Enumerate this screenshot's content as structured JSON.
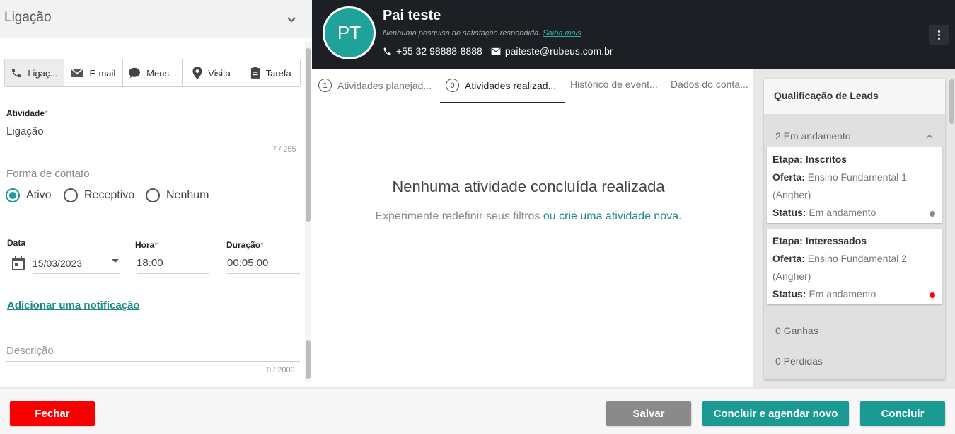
{
  "left": {
    "title": "Ligação",
    "tabs": [
      {
        "label": "Ligaç...",
        "icon": "phone-icon"
      },
      {
        "label": "E-mail",
        "icon": "mail-icon"
      },
      {
        "label": "Mens...",
        "icon": "chat-icon"
      },
      {
        "label": "Visita",
        "icon": "location-pin-icon"
      },
      {
        "label": "Tarefa",
        "icon": "clipboard-icon"
      }
    ],
    "atividade": {
      "label": "Atividade",
      "required": "*",
      "value": "Ligação",
      "counter": "7 / 255"
    },
    "forma_contato": {
      "label": "Forma de contato",
      "options": [
        "Ativo",
        "Receptivo",
        "Nenhum"
      ],
      "selected": "Ativo"
    },
    "data": {
      "label": "Data",
      "value": "15/03/2023"
    },
    "hora": {
      "label": "Hora",
      "required": "*",
      "value": "18:00"
    },
    "duracao": {
      "label": "Duração",
      "required": "*",
      "value": "00:05:00"
    },
    "add_notification": "Adicionar uma notificação",
    "descricao": {
      "placeholder": "Descrição",
      "counter": "0 / 2000"
    }
  },
  "header": {
    "initials": "PT",
    "name": "Pai teste",
    "survey_text": "Nenhuma pesquisa de satisfação respondida.",
    "survey_link": "Saiba mais",
    "phone": "+55 32 98888-8888",
    "email": "paiteste@rubeus.com.br"
  },
  "center": {
    "tabs": [
      {
        "num": "1",
        "label": "Atividades planejad..."
      },
      {
        "num": "0",
        "label": "Atividades realizad..."
      },
      {
        "num": "",
        "label": "Histórico de event..."
      },
      {
        "num": "",
        "label": "Dados do conta..."
      }
    ],
    "active_tab": 1,
    "empty_title": "Nenhuma atividade concluída realizada",
    "empty_sub": "Experimente redefinir seus filtros",
    "empty_link": "ou crie uma atividade nova."
  },
  "qualification": {
    "title": "Qualificação de Leads",
    "in_progress": "2 Em andamento",
    "stages": [
      {
        "etapa_label": "Etapa:",
        "etapa": "Inscritos",
        "oferta_label": "Oferta:",
        "oferta": "Ensino Fundamental 1",
        "oferta2": "(Angher)",
        "status_label": "Status:",
        "status": "Em andamento",
        "dot_color": "#888888"
      },
      {
        "etapa_label": "Etapa:",
        "etapa": "Interessados",
        "oferta_label": "Oferta:",
        "oferta": "Ensino Fundamental 2",
        "oferta2": "(Angher)",
        "status_label": "Status:",
        "status": "Em andamento",
        "dot_color": "#ff0000"
      }
    ],
    "won": "0 Ganhas",
    "lost": "0 Perdidas"
  },
  "footer": {
    "fechar": "Fechar",
    "salvar": "Salvar",
    "concluir_agendar": "Concluir e agendar novo",
    "concluir": "Concluir"
  },
  "colors": {
    "accent": "#1a9a92",
    "danger": "#f80000",
    "header_bg": "#1c1f24"
  }
}
